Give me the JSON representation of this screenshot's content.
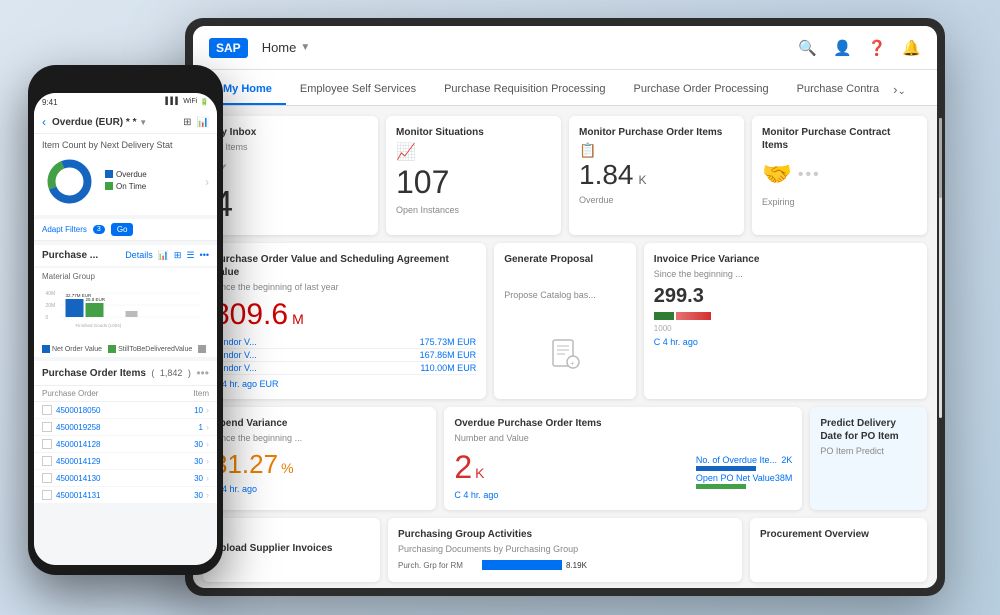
{
  "header": {
    "logo": "SAP",
    "home_label": "Home",
    "home_arrow": "▼",
    "icons": [
      "🔍",
      "👤",
      "❓",
      "🔔"
    ]
  },
  "nav": {
    "tabs": [
      {
        "label": "My Home",
        "active": true
      },
      {
        "label": "Employee Self Services",
        "active": false
      },
      {
        "label": "Purchase Requisition Processing",
        "active": false
      },
      {
        "label": "Purchase Order Processing",
        "active": false
      },
      {
        "label": "Purchase Contra",
        "active": false
      }
    ],
    "arrow": "›",
    "expand": "⌄"
  },
  "tiles": {
    "row1": [
      {
        "id": "my-inbox",
        "title": "My Inbox",
        "subtitle": "All Items",
        "icon": "✓",
        "value": "4",
        "unit": ""
      },
      {
        "id": "monitor-situations",
        "title": "Monitor Situations",
        "subtitle": "",
        "icon": "📈",
        "value": "107",
        "unit": "",
        "footer": "Open Instances"
      },
      {
        "id": "monitor-po-items",
        "title": "Monitor Purchase Order Items",
        "subtitle": "",
        "icon": "📋",
        "value": "1.84",
        "unit": "K",
        "footer": "Overdue"
      },
      {
        "id": "monitor-contract-items",
        "title": "Monitor Purchase Contract Items",
        "subtitle": "",
        "icon": "🤝",
        "footer": "Expiring"
      }
    ],
    "row2_left": {
      "id": "po-value",
      "title": "Purchase Order Value and Scheduling Agreement Value",
      "subtitle": "Since the beginning of last year",
      "value": "809.6",
      "unit": "M",
      "vendors": [
        {
          "label": "Vendor V...",
          "value": "175.73M EUR"
        },
        {
          "label": "Vendor V...",
          "value": "167.86M EUR"
        },
        {
          "label": "Vendor V...",
          "value": "110.00M EUR"
        }
      ],
      "footer": "C 4 hr. ago   EUR"
    },
    "row2_mid": {
      "id": "generate-proposal",
      "title": "Generate Proposal",
      "subtitle": "Propose Catalog bas..."
    },
    "row2_right": {
      "id": "invoice-price-variance",
      "title": "Invoice Price Variance",
      "subtitle": "Since the beginning ...",
      "value": "299.3",
      "scale_min": "1000",
      "footer": "C 4 hr. ago"
    },
    "row3_left": {
      "id": "spend-variance",
      "title": "Spend Variance",
      "subtitle": "Since the beginning ...",
      "value": "31.27",
      "unit": "%",
      "footer": "C 4 hr. ago"
    },
    "row3_mid": {
      "id": "overdue-po-items",
      "title": "Overdue Purchase Order Items",
      "subtitle": "Number and Value",
      "value": "2",
      "unit": "K",
      "stat1_label": "No. of Overdue Ite...",
      "stat1_value": "2K",
      "stat2_label": "Open PO Net Value",
      "stat2_value": "38M",
      "footer": "C 4 hr. ago"
    },
    "row3_right": {
      "id": "predict-delivery",
      "title": "Predict Delivery Date for PO Item",
      "subtitle": "PO Item Predict"
    },
    "row4": [
      {
        "id": "upload-invoices",
        "title": "Upload Supplier Invoices"
      },
      {
        "id": "purchasing-group",
        "title": "Purchasing Group Activities",
        "subtitle": "Purchasing Documents by Purchasing Group",
        "bar_label": "Purch. Grp for RM",
        "bar_value": "8.19K"
      },
      {
        "id": "procurement-overview",
        "title": "Procurement Overview"
      }
    ]
  },
  "phone": {
    "status_time": "9:41",
    "title": "Overdue (EUR) *",
    "subtitle": "",
    "chart_title": "Item Count by Next Delivery Stat",
    "legend": [
      {
        "label": "Overdue",
        "color": "blue"
      },
      {
        "label": "On Time",
        "color": "green"
      }
    ],
    "filters_label": "Adapt Filters",
    "filters_count": "3",
    "go_label": "Go",
    "section_title": "Purchase ...",
    "details_label": "Details",
    "material_group_label": "Material Group",
    "bars": [
      {
        "label": "Finished Goods (L004)",
        "value1": 32.77,
        "value2": 25.8,
        "unit1": "EUR",
        "unit2": "EUR"
      }
    ],
    "list_title": "Purchase Order Items",
    "list_count": "1,842",
    "list_col_po": "Purchase Order",
    "list_col_item": "Item",
    "list_rows": [
      {
        "po": "4500018050",
        "item": "10"
      },
      {
        "po": "4500019258",
        "item": "1"
      },
      {
        "po": "4500014128",
        "item": "30"
      },
      {
        "po": "4500014129",
        "item": "30"
      },
      {
        "po": "4500014130",
        "item": "30"
      },
      {
        "po": "4500014131",
        "item": "30"
      }
    ]
  }
}
